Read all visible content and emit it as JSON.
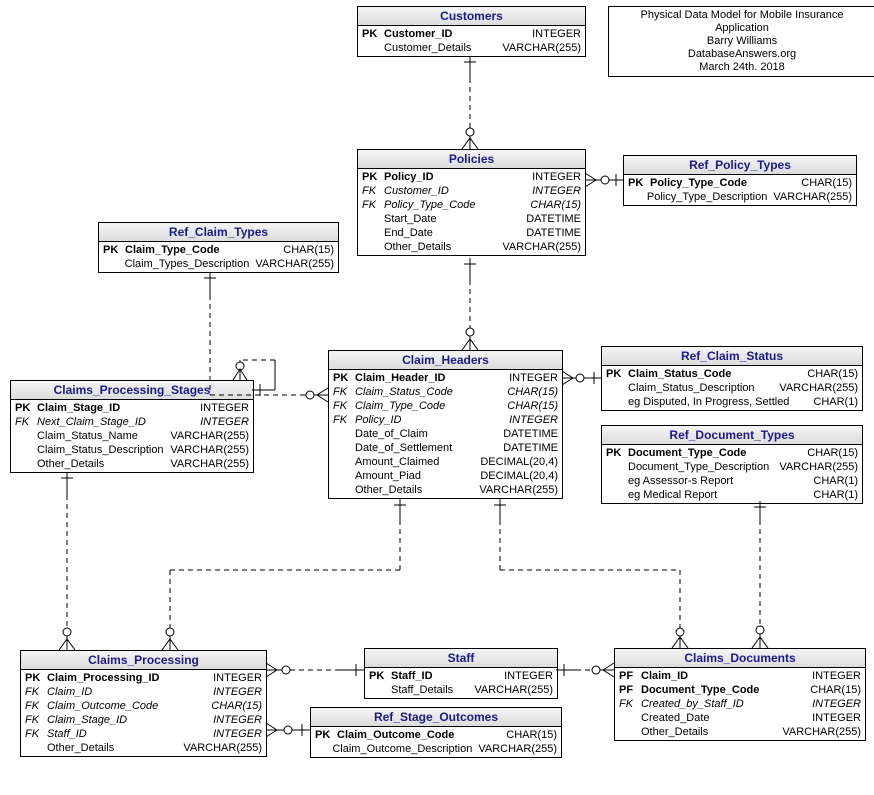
{
  "info": {
    "line1": "Physical Data Model for Mobile Insurance Application",
    "line2": "Barry Williams",
    "line3": "DatabaseAnswers.org",
    "line4": "March 24th. 2018"
  },
  "entities": {
    "customers": {
      "title": "Customers",
      "rows": [
        {
          "k": "PK",
          "n": "Customer_ID",
          "t": "INTEGER",
          "pk": true
        },
        {
          "k": "",
          "n": "Customer_Details",
          "t": "VARCHAR(255)"
        }
      ]
    },
    "policies": {
      "title": "Policies",
      "rows": [
        {
          "k": "PK",
          "n": "Policy_ID",
          "t": "INTEGER",
          "pk": true
        },
        {
          "k": "FK",
          "n": "Customer_ID",
          "t": "INTEGER",
          "fk": true
        },
        {
          "k": "FK",
          "n": "Policy_Type_Code",
          "t": "CHAR(15)",
          "fk": true
        },
        {
          "k": "",
          "n": "Start_Date",
          "t": "DATETIME"
        },
        {
          "k": "",
          "n": "End_Date",
          "t": "DATETIME"
        },
        {
          "k": "",
          "n": "Other_Details",
          "t": "VARCHAR(255)"
        }
      ]
    },
    "ref_policy_types": {
      "title": "Ref_Policy_Types",
      "rows": [
        {
          "k": "PK",
          "n": "Policy_Type_Code",
          "t": "CHAR(15)",
          "pk": true
        },
        {
          "k": "",
          "n": "Policy_Type_Description",
          "t": "VARCHAR(255)"
        }
      ]
    },
    "ref_claim_types": {
      "title": "Ref_Claim_Types",
      "rows": [
        {
          "k": "PK",
          "n": "Claim_Type_Code",
          "t": "CHAR(15)",
          "pk": true
        },
        {
          "k": "",
          "n": "Claim_Types_Description",
          "t": "VARCHAR(255)"
        }
      ]
    },
    "claim_headers": {
      "title": "Claim_Headers",
      "rows": [
        {
          "k": "PK",
          "n": "Claim_Header_ID",
          "t": "INTEGER",
          "pk": true
        },
        {
          "k": "FK",
          "n": "Claim_Status_Code",
          "t": "CHAR(15)",
          "fk": true
        },
        {
          "k": "FK",
          "n": "Claim_Type_Code",
          "t": "CHAR(15)",
          "fk": true
        },
        {
          "k": "FK",
          "n": "Policy_ID",
          "t": "INTEGER",
          "fk": true
        },
        {
          "k": "",
          "n": "Date_of_Claim",
          "t": "DATETIME"
        },
        {
          "k": "",
          "n": "Date_of_Settlement",
          "t": "DATETIME"
        },
        {
          "k": "",
          "n": "Amount_Claimed",
          "t": "DECIMAL(20,4)"
        },
        {
          "k": "",
          "n": "Amount_Piad",
          "t": "DECIMAL(20,4)"
        },
        {
          "k": "",
          "n": "Other_Details",
          "t": "VARCHAR(255)"
        }
      ]
    },
    "ref_claim_status": {
      "title": "Ref_Claim_Status",
      "rows": [
        {
          "k": "PK",
          "n": "Claim_Status_Code",
          "t": "CHAR(15)",
          "pk": true
        },
        {
          "k": "",
          "n": "Claim_Status_Description",
          "t": "VARCHAR(255)"
        },
        {
          "k": "",
          "n": "eg Disputed, In Progress, Settled",
          "t": "CHAR(1)"
        }
      ]
    },
    "ref_document_types": {
      "title": "Ref_Document_Types",
      "rows": [
        {
          "k": "PK",
          "n": "Document_Type_Code",
          "t": "CHAR(15)",
          "pk": true
        },
        {
          "k": "",
          "n": "Document_Type_Description",
          "t": "VARCHAR(255)"
        },
        {
          "k": "",
          "n": "eg Assessor-s Report",
          "t": "CHAR(1)"
        },
        {
          "k": "",
          "n": "eg Medical Report",
          "t": "CHAR(1)"
        }
      ]
    },
    "claims_processing_stages": {
      "title": "Claims_Processing_Stages",
      "rows": [
        {
          "k": "PK",
          "n": "Claim_Stage_ID",
          "t": "INTEGER",
          "pk": true
        },
        {
          "k": "FK",
          "n": "Next_Claim_Stage_ID",
          "t": "INTEGER",
          "fk": true
        },
        {
          "k": "",
          "n": "Claim_Status_Name",
          "t": "VARCHAR(255)"
        },
        {
          "k": "",
          "n": "Claim_Status_Description",
          "t": "VARCHAR(255)"
        },
        {
          "k": "",
          "n": "Other_Details",
          "t": "VARCHAR(255)"
        }
      ]
    },
    "claims_processing": {
      "title": "Claims_Processing",
      "rows": [
        {
          "k": "PK",
          "n": "Claim_Processing_ID",
          "t": "INTEGER",
          "pk": true
        },
        {
          "k": "FK",
          "n": "Claim_ID",
          "t": "INTEGER",
          "fk": true
        },
        {
          "k": "FK",
          "n": "Claim_Outcome_Code",
          "t": "CHAR(15)",
          "fk": true
        },
        {
          "k": "FK",
          "n": "Claim_Stage_ID",
          "t": "INTEGER",
          "fk": true
        },
        {
          "k": "FK",
          "n": "Staff_ID",
          "t": "INTEGER",
          "fk": true
        },
        {
          "k": "",
          "n": "Other_Details",
          "t": "VARCHAR(255)"
        }
      ]
    },
    "staff": {
      "title": "Staff",
      "rows": [
        {
          "k": "PK",
          "n": "Staff_ID",
          "t": "INTEGER",
          "pk": true
        },
        {
          "k": "",
          "n": "Staff_Details",
          "t": "VARCHAR(255)"
        }
      ]
    },
    "ref_stage_outcomes": {
      "title": "Ref_Stage_Outcomes",
      "rows": [
        {
          "k": "PK",
          "n": "Claim_Outcome_Code",
          "t": "CHAR(15)",
          "pk": true
        },
        {
          "k": "",
          "n": "Claim_Outcome_Description",
          "t": "VARCHAR(255)"
        }
      ]
    },
    "claims_documents": {
      "title": "Claims_Documents",
      "rows": [
        {
          "k": "PF",
          "n": "Claim_ID",
          "t": "INTEGER",
          "pk": true
        },
        {
          "k": "PF",
          "n": "Document_Type_Code",
          "t": "CHAR(15)",
          "pk": true
        },
        {
          "k": "FK",
          "n": "Created_by_Staff_ID",
          "t": "INTEGER",
          "fk": true
        },
        {
          "k": "",
          "n": "Created_Date",
          "t": "INTEGER"
        },
        {
          "k": "",
          "n": "Other_Details",
          "t": "VARCHAR(255)"
        }
      ]
    }
  }
}
